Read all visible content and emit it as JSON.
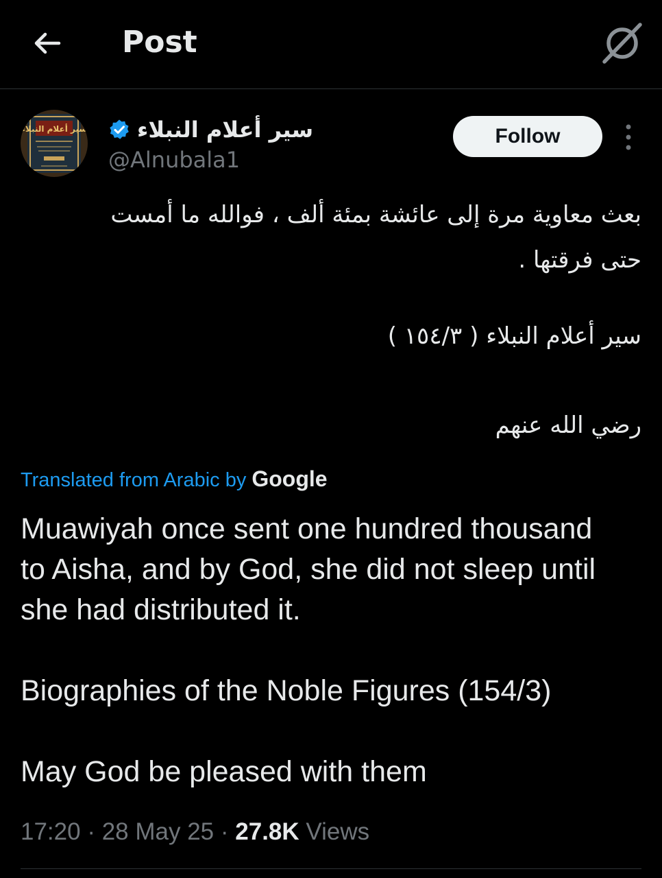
{
  "header": {
    "title": "Post"
  },
  "author": {
    "display_name": "سير أعلام النبلاء",
    "handle": "@Alnubala1",
    "verified": true,
    "follow_label": "Follow",
    "avatar_book_title": "سير أعلام النبلاء"
  },
  "post": {
    "arabic_line1": "بعث معاوية مرة إلى عائشة بمئة ألف ، فوالله ما أمست",
    "arabic_line2": "حتى فرقتها .",
    "arabic_reference": "سير أعلام النبلاء ( ١٥٤/٣ )",
    "arabic_closing": "رضي الله عنهم",
    "translated_label": "Translated from Arabic by",
    "translated_provider": "Google",
    "translation_line1": "Muawiyah once sent one hundred thousand",
    "translation_line2": "to Aisha, and by God, she did not sleep until",
    "translation_line3": "she had distributed it.",
    "translation_reference": "Biographies of the Noble Figures (154/3)",
    "translation_closing": "May God be pleased with them"
  },
  "meta": {
    "time": "17:20",
    "separator": "·",
    "date": "28 May 25",
    "views_count": "27.8K",
    "views_label": "Views"
  },
  "colors": {
    "background": "#000000",
    "accent": "#1d9bf0",
    "text_primary": "#e7e9ea",
    "text_secondary": "#71767b"
  },
  "icons": {
    "back": "arrow-left-icon",
    "grok": "grok-icon",
    "verified": "verified-badge-icon",
    "more": "more-vertical-icon"
  }
}
